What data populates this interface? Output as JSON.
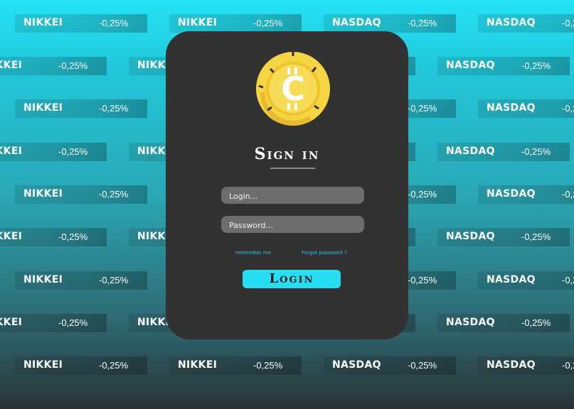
{
  "tickers": [
    {
      "name": "NIKKEI",
      "change": "-0,25%"
    },
    {
      "name": "NASDAQ",
      "change": "-0,25%"
    }
  ],
  "login_form": {
    "title": "Sign in",
    "login_placeholder": "Login...",
    "password_placeholder": "Password...",
    "remember_me": "remember me",
    "forgot_password": "Forgot password ?",
    "submit_label": "Login"
  },
  "logo": {
    "icon": "crypto-coin-icon",
    "symbol": "C"
  },
  "colors": {
    "accent": "#28def3",
    "card_background": "#323232",
    "field_background": "#6d6d6d",
    "coin_gold": "#f5d541"
  }
}
